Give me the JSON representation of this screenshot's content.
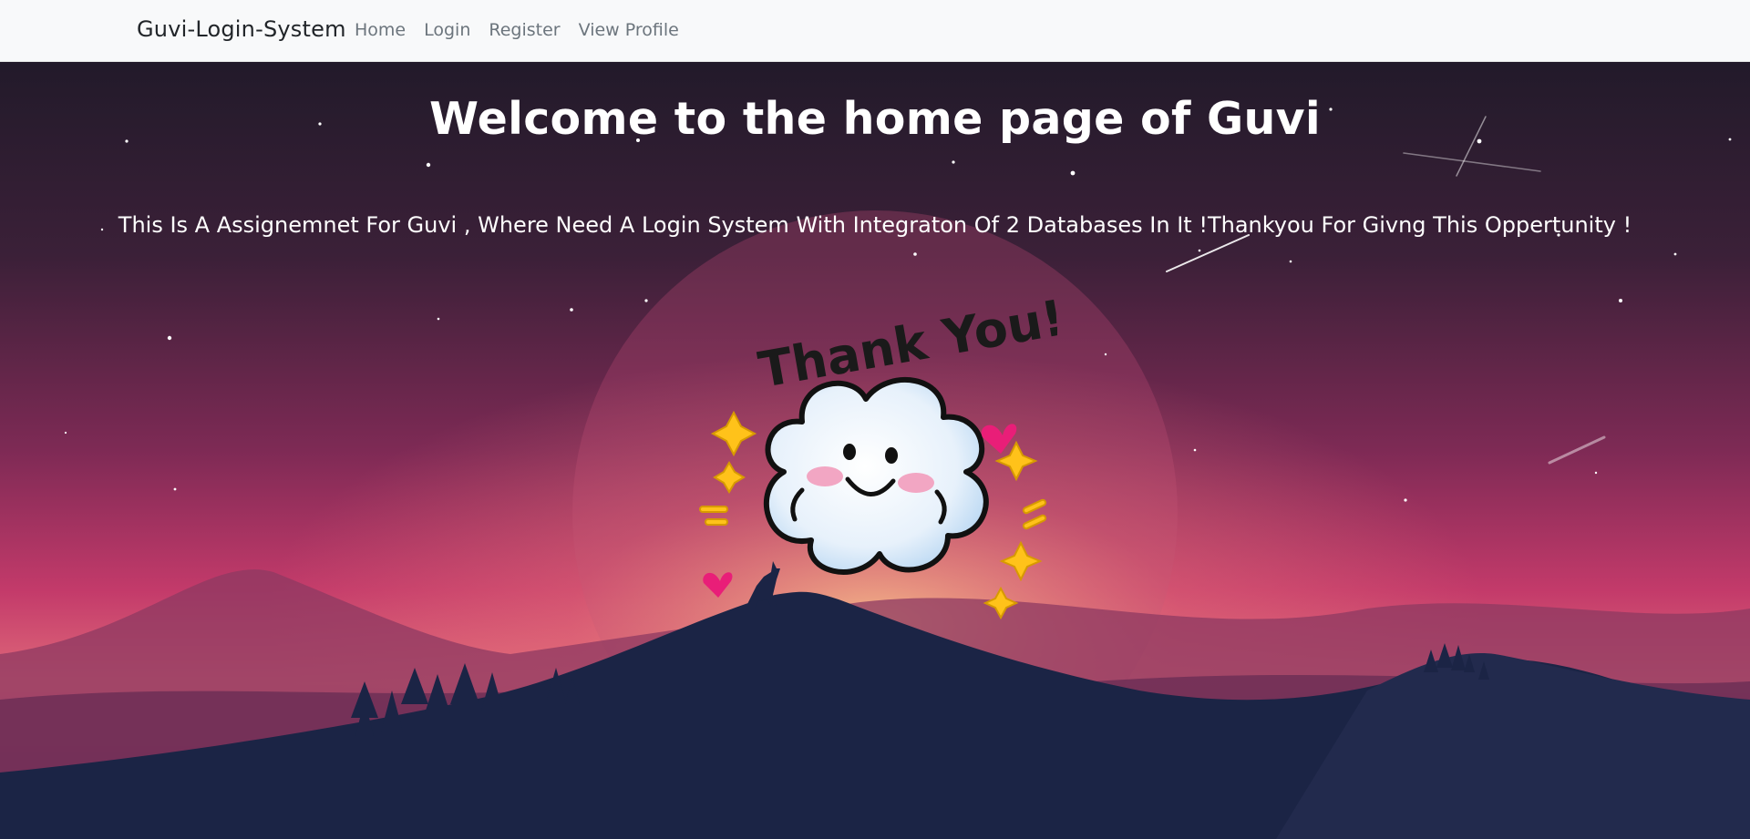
{
  "navbar": {
    "brand": "Guvi-Login-System",
    "links": [
      "Home",
      "Login",
      "Register",
      "View Profile"
    ]
  },
  "main": {
    "title": "Welcome to the home page of Guvi",
    "description": "This Is A Assignemnet For Guvi , Where Need A Login System With Integraton Of 2 Databases In It !Thankyou For Givng This Oppertunity !",
    "sticker_text": "Thank You!"
  },
  "colors": {
    "navbar_bg": "#f8f9fa",
    "sky_top": "#231a2b",
    "sky_mid": "#8a2d5c",
    "sky_glow": "#f0a07a",
    "mountain": "#1b2445",
    "text": "#ffffff"
  },
  "icons": [
    "wolf-silhouette",
    "pine-trees",
    "moon",
    "shooting-star",
    "cloud-mascot",
    "sparkle",
    "heart"
  ]
}
